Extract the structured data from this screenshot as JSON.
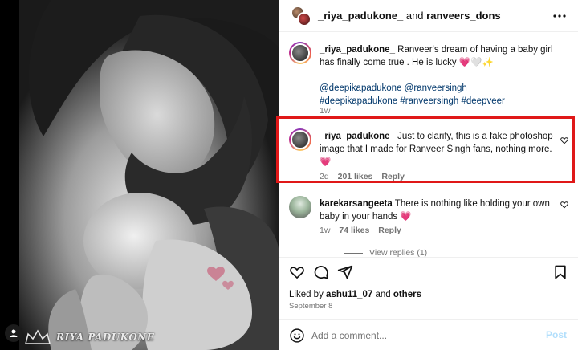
{
  "header": {
    "user1": "_riya_padukone_",
    "and": "and",
    "user2": "ranveers_dons"
  },
  "photo": {
    "watermark": "RIYA PADUKONE"
  },
  "comments": [
    {
      "username": "_riya_padukone_",
      "text": "Ranveer's dream of having a baby girl has finally come true . He is lucky 💗🤍✨",
      "mentions": "@deepikapadukone @ranveersingh",
      "hashtags": "#deepikapadukone #ranveersingh #deepveer",
      "time": "1w"
    },
    {
      "username": "_riya_padukone_",
      "text": "Just to clarify, this is a fake photoshop image that I made for Ranveer Singh fans, nothing more. 💗",
      "time": "2d",
      "likes": "201 likes",
      "reply": "Reply"
    },
    {
      "username": "karekarsangeeta",
      "text": "There is nothing like holding your own baby in your hands 💗",
      "time": "1w",
      "likes": "74 likes",
      "reply": "Reply"
    }
  ],
  "view_replies": "View replies (1)",
  "likes_line": {
    "prefix": "Liked by",
    "user": "ashu11_07",
    "middle": "and",
    "suffix": "others"
  },
  "post_date": "September 8",
  "add_comment": {
    "placeholder": "Add a comment...",
    "post_label": "Post"
  },
  "colors": {
    "highlight": "#e01818",
    "link": "#00376b",
    "post_disabled": "#b2dffc",
    "meta": "#737373"
  }
}
